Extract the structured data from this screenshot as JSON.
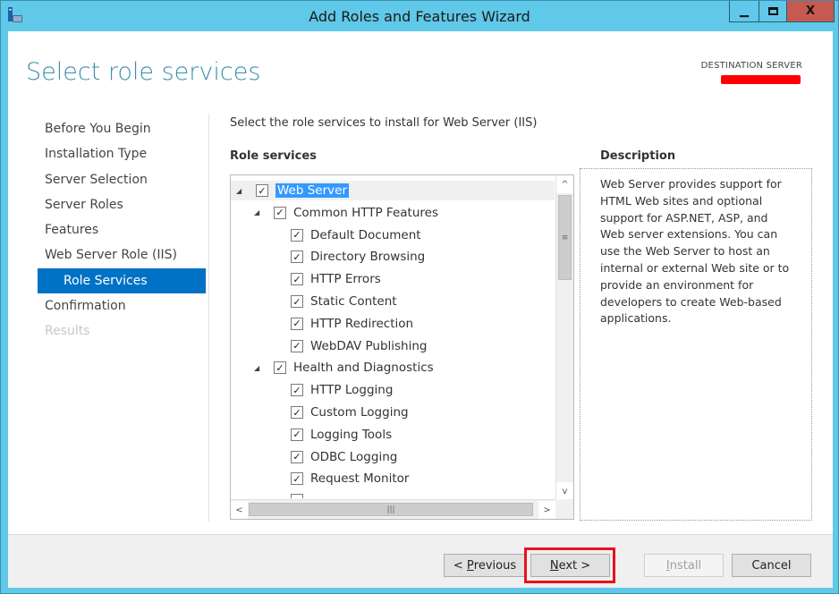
{
  "window": {
    "title": "Add Roles and Features Wizard",
    "controls": {
      "minimize": "▁",
      "maximize": "□",
      "close": "X"
    }
  },
  "header": {
    "page_title": "Select role services",
    "destination_label": "DESTINATION SERVER",
    "redaction_color": "#ff0000"
  },
  "nav": {
    "items": [
      {
        "label": "Before You Begin",
        "state": "normal"
      },
      {
        "label": "Installation Type",
        "state": "normal"
      },
      {
        "label": "Server Selection",
        "state": "normal"
      },
      {
        "label": "Server Roles",
        "state": "normal"
      },
      {
        "label": "Features",
        "state": "normal"
      },
      {
        "label": "Web Server Role (IIS)",
        "state": "normal"
      },
      {
        "label": "Role Services",
        "state": "active"
      },
      {
        "label": "Confirmation",
        "state": "normal"
      },
      {
        "label": "Results",
        "state": "disabled"
      }
    ]
  },
  "main": {
    "intro": "Select the role services to install for Web Server (IIS)",
    "role_services_heading": "Role services",
    "description_heading": "Description",
    "description": "Web Server provides support for HTML Web sites and optional support for ASP.NET, ASP, and Web server extensions. You can use the Web Server to host an internal or external Web site or to provide an environment for developers to create Web-based applications.",
    "tree": [
      {
        "label": "Web Server",
        "level": 0,
        "expandable": true,
        "checked": true,
        "selected": true
      },
      {
        "label": "Common HTTP Features",
        "level": 1,
        "expandable": true,
        "checked": true
      },
      {
        "label": "Default Document",
        "level": 2,
        "checked": true
      },
      {
        "label": "Directory Browsing",
        "level": 2,
        "checked": true
      },
      {
        "label": "HTTP Errors",
        "level": 2,
        "checked": true
      },
      {
        "label": "Static Content",
        "level": 2,
        "checked": true
      },
      {
        "label": "HTTP Redirection",
        "level": 2,
        "checked": true
      },
      {
        "label": "WebDAV Publishing",
        "level": 2,
        "checked": true
      },
      {
        "label": "Health and Diagnostics",
        "level": 1,
        "expandable": true,
        "checked": true
      },
      {
        "label": "HTTP Logging",
        "level": 2,
        "checked": true
      },
      {
        "label": "Custom Logging",
        "level": 2,
        "checked": true
      },
      {
        "label": "Logging Tools",
        "level": 2,
        "checked": true
      },
      {
        "label": "ODBC Logging",
        "level": 2,
        "checked": true
      },
      {
        "label": "Request Monitor",
        "level": 2,
        "checked": true
      }
    ],
    "scroll": {
      "up": "^",
      "down": "v",
      "left": "<",
      "right": ">",
      "vgrip": "≡",
      "hgrip": "|||"
    }
  },
  "footer": {
    "previous": {
      "prefix": "< ",
      "mnemonic": "P",
      "rest": "revious"
    },
    "next": {
      "mnemonic": "N",
      "rest": "ext >"
    },
    "install": {
      "mnemonic": "I",
      "rest": "nstall"
    },
    "cancel": "Cancel",
    "highlight_color": "#e8121e"
  }
}
